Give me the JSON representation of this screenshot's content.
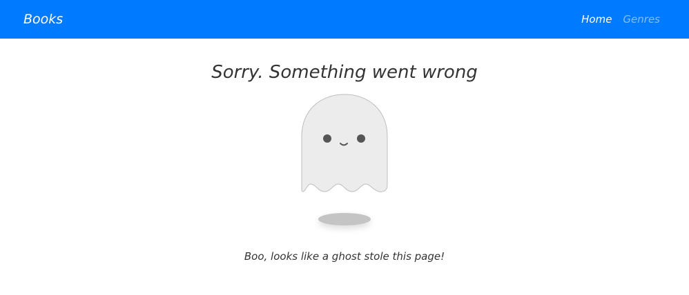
{
  "navbar": {
    "brand": "Books",
    "links": [
      {
        "label": "Home",
        "active": true
      },
      {
        "label": "Genres",
        "active": false
      }
    ],
    "background": "#007bff"
  },
  "main": {
    "title": "Sorry. Something went wrong",
    "message": "Boo, looks like a ghost stole this page!",
    "illustration": "ghost-icon"
  }
}
